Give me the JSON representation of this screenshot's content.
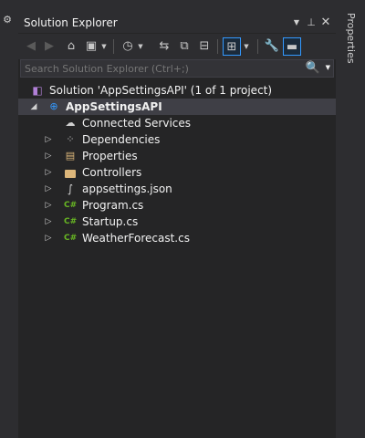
{
  "panel": {
    "title": "Solution Explorer"
  },
  "title_buttons": [
    "chevron-down-icon",
    "pin-icon",
    "close-icon"
  ],
  "search": {
    "placeholder": "Search Solution Explorer (Ctrl+;)"
  },
  "side_tab": {
    "label": "Properties"
  },
  "tree": {
    "solution": "Solution 'AppSettingsAPI' (1 of 1 project)",
    "project": "AppSettingsAPI",
    "items": [
      {
        "label": "Connected Services",
        "icon": "connected-services-icon",
        "expandable": false
      },
      {
        "label": "Dependencies",
        "icon": "dependencies-icon",
        "expandable": true
      },
      {
        "label": "Properties",
        "icon": "properties-icon",
        "expandable": true
      },
      {
        "label": "Controllers",
        "icon": "folder-icon",
        "expandable": true
      },
      {
        "label": "appsettings.json",
        "icon": "json-file-icon",
        "expandable": true
      },
      {
        "label": "Program.cs",
        "icon": "csharp-file-icon",
        "expandable": true
      },
      {
        "label": "Startup.cs",
        "icon": "csharp-file-icon",
        "expandable": true
      },
      {
        "label": "WeatherForecast.cs",
        "icon": "csharp-file-icon",
        "expandable": true
      }
    ]
  },
  "colors": {
    "accent": "#3399ff",
    "csharp": "#68b723",
    "folder": "#dcb67a",
    "solution": "#b180d7"
  }
}
